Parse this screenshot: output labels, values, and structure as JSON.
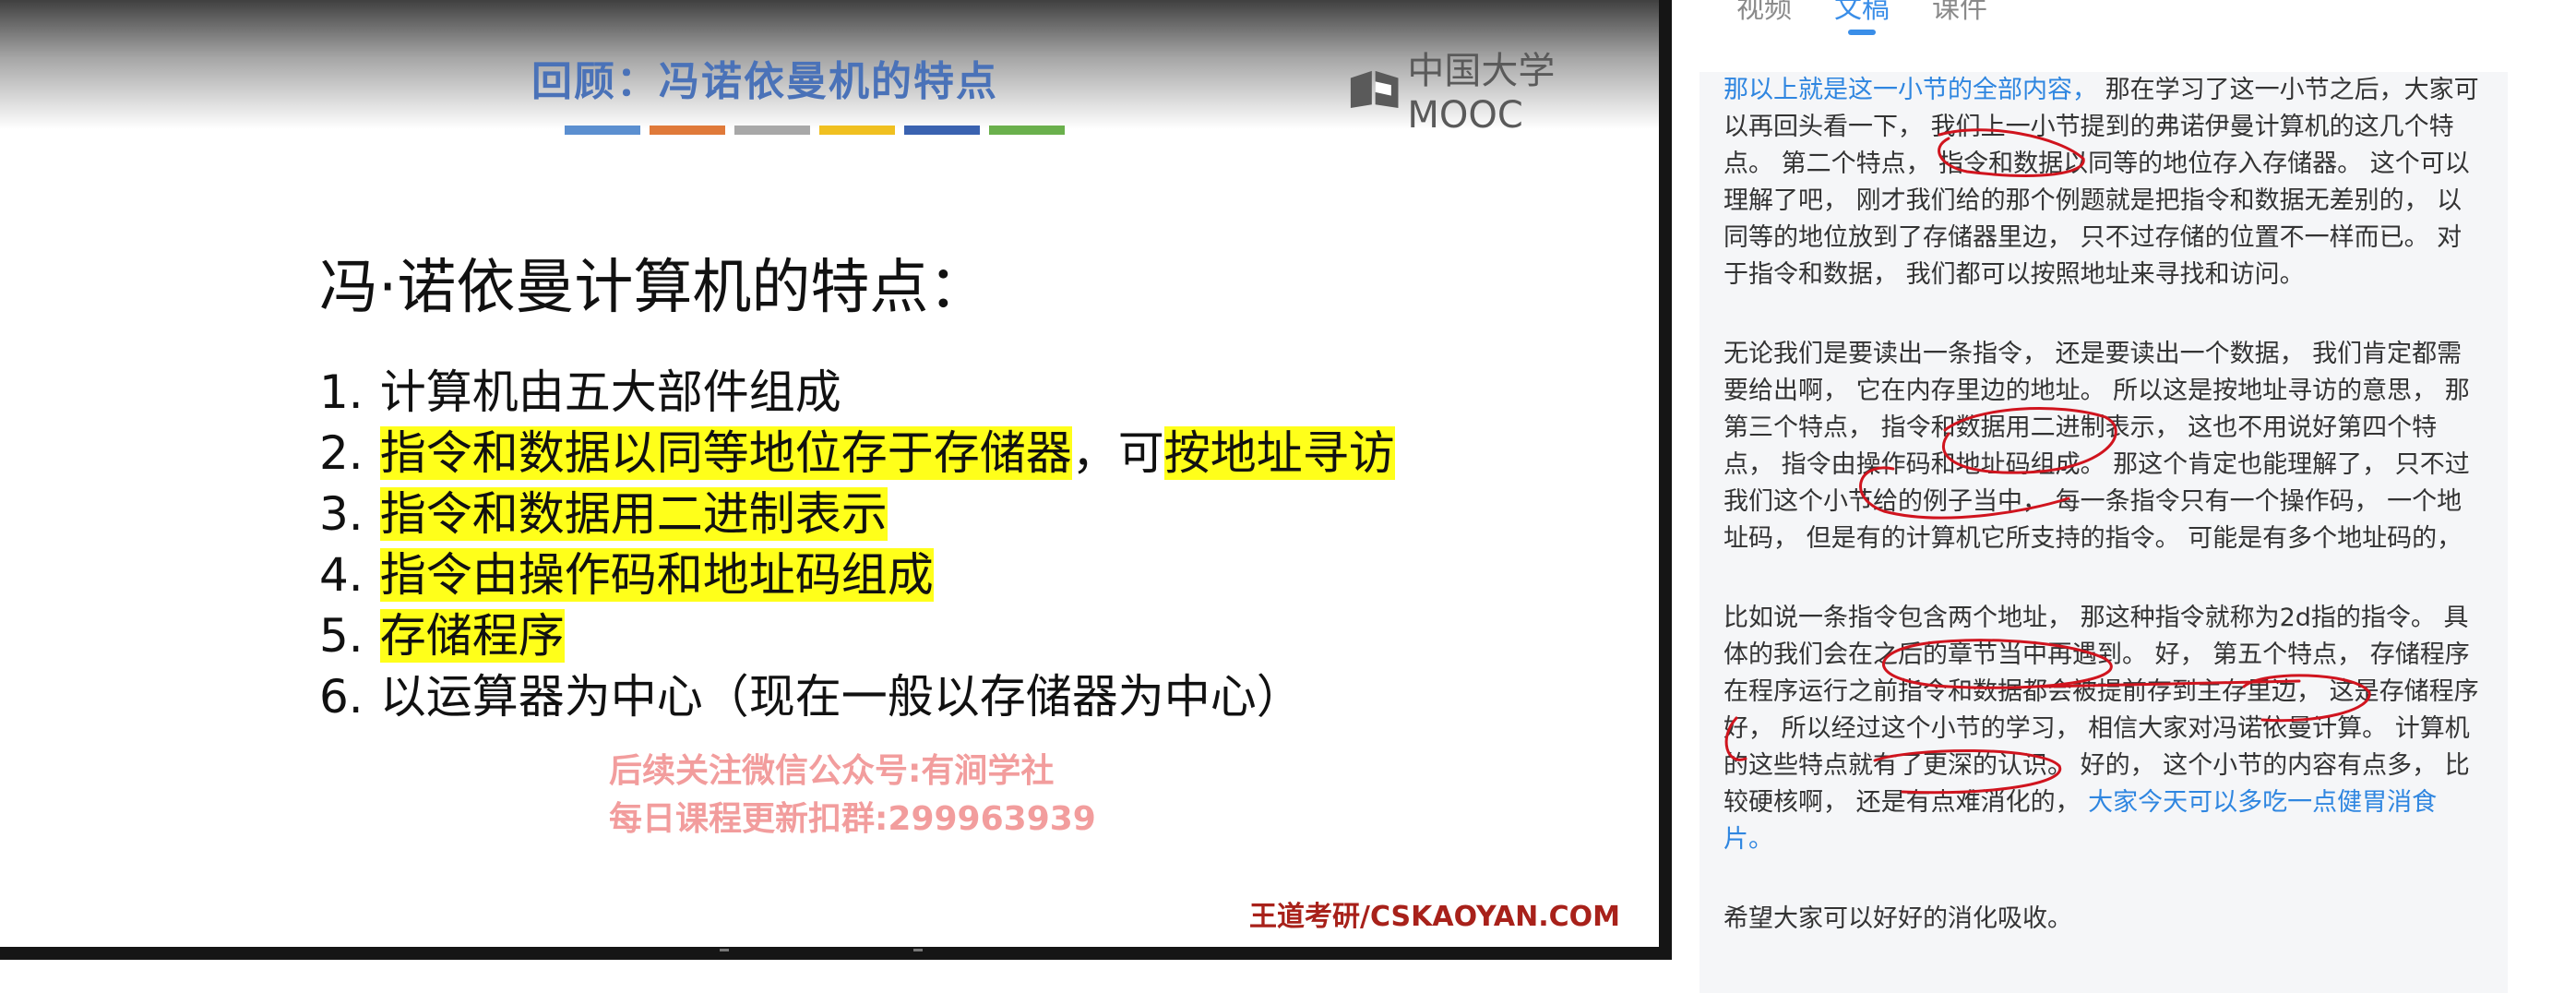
{
  "slide": {
    "title": "回顾：冯诺依曼机的特点",
    "logo": "中国大学MOOC",
    "stripe_colors": [
      "#5b8fd0",
      "#e07a3a",
      "#a8a8a8",
      "#f0c020",
      "#3a62b0",
      "#6ab04c"
    ],
    "heading": "冯·诺依曼计算机的特点：",
    "features": [
      {
        "num": "1.",
        "parts": [
          {
            "text": "计算机由五大部件组成",
            "hl": false
          }
        ]
      },
      {
        "num": "2.",
        "parts": [
          {
            "text": "指令和数据以同等地位存于存储器",
            "hl": true
          },
          {
            "text": "，可",
            "hl": false
          },
          {
            "text": "按地址寻访",
            "hl": true
          }
        ]
      },
      {
        "num": "3.",
        "parts": [
          {
            "text": "指令和数据用二进制表示",
            "hl": true
          }
        ]
      },
      {
        "num": "4.",
        "parts": [
          {
            "text": "指令由操作码和地址码组成",
            "hl": true
          }
        ]
      },
      {
        "num": "5.",
        "parts": [
          {
            "text": "存储程序",
            "hl": true
          }
        ]
      },
      {
        "num": "6.",
        "parts": [
          {
            "text": "以运算器为中心（现在一般以存储器为中心）",
            "hl": false
          }
        ]
      }
    ],
    "watermark_line1": "后续关注微信公众号:有涧学社",
    "watermark_line2": "每日课程更新扣群:299963939",
    "footer": "王道考研/CSKAOYAN.COM"
  },
  "tabs": [
    {
      "label": "视频",
      "active": false
    },
    {
      "label": "文稿",
      "active": true
    },
    {
      "label": "课件",
      "active": false
    }
  ],
  "transcript": [
    [
      {
        "text": "那以上就是这一小节的全部内容，",
        "blue": true
      },
      {
        "text": " 那在学习了这一小节之后，大家可以再回头看一下， 我们上一小节提到的弗诺伊曼计算机的这几个特点。 第二个特点， 指令和数据以同等的地位存入存储器。 这个可以理解了吧， 刚才我们给的那个例题就是把指令和数据无差别的， 以同等的地位放到了存储器里边， 只不过存储的位置不一样而已。 对于指令和数据， 我们都可以按照地址来寻找和访问。",
        "blue": false
      }
    ],
    [
      {
        "text": "无论我们是要读出一条指令， 还是要读出一个数据， 我们肯定都需要给出啊， 它在内存里边的地址。 所以这是按地址寻访的意思， 那第三个特点， 指令和数据用二进制表示， 这也不用说好第四个特点， 指令由操作码和地址码组成。 那这个肯定也能理解了， 只不过我们这个小节给的例子当中， 每一条指令只有一个操作码， 一个地址码， 但是有的计算机它所支持的指令。 可能是有多个地址码的，",
        "blue": false
      }
    ],
    [
      {
        "text": "比如说一条指令包含两个地址， 那这种指令就称为2d指的指令。 具体的我们会在之后的章节当中再遇到。 好， 第五个特点， 存储程序在程序运行之前指令和数据都会被提前存到主存里边， 这是存储程序好， 所以经过这个小节的学习， 相信大家对冯诺依曼计算。 计算机的这些特点就有了更深的认识。 好的， 这个小节的内容有点多， 比较硬核啊， 还是有点难消化的，",
        "blue": false
      },
      {
        "text": " 大家今天可以多吃一点健胃消食片。",
        "blue": true
      }
    ],
    [
      {
        "text": "希望大家可以好好的消化吸收。",
        "blue": false
      }
    ]
  ]
}
